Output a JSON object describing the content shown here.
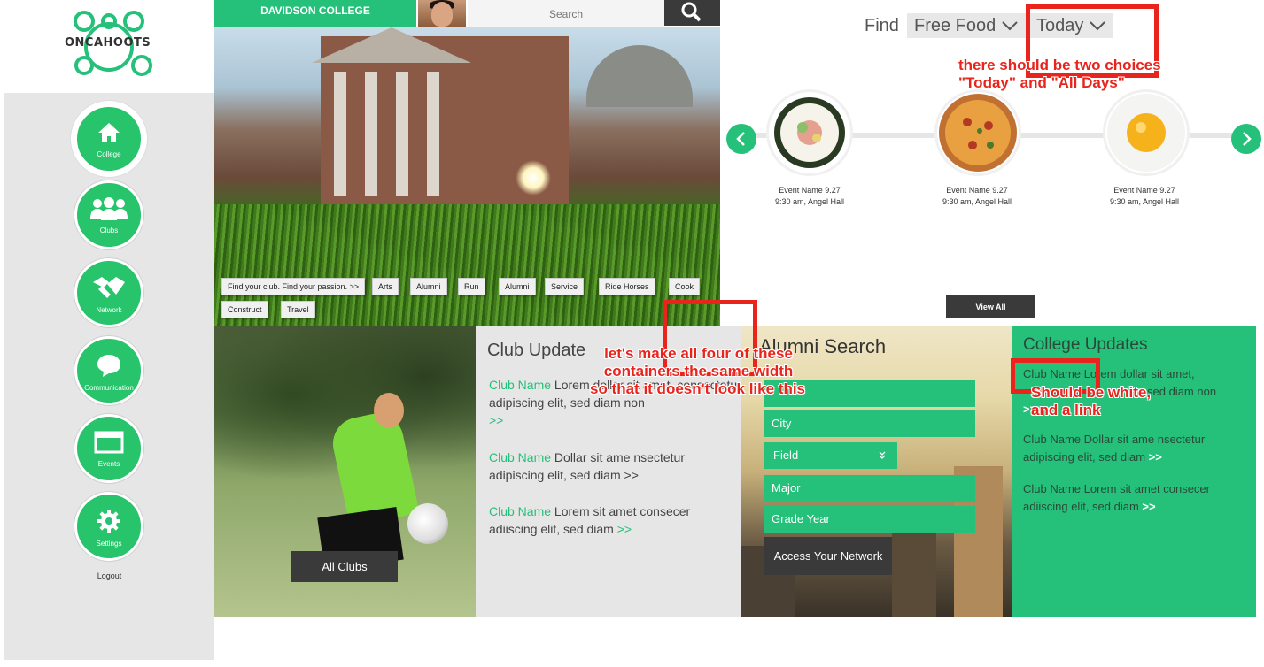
{
  "brand": {
    "logo_text": "ONCAHOOTS"
  },
  "sidebar": {
    "items": [
      {
        "label": "College",
        "icon": "home-icon"
      },
      {
        "label": "Clubs",
        "icon": "group-icon"
      },
      {
        "label": "Network",
        "icon": "handshake-icon"
      },
      {
        "label": "Communication",
        "icon": "chat-bubble-icon"
      },
      {
        "label": "Events",
        "icon": "calendar-window-icon"
      },
      {
        "label": "Settings",
        "icon": "gear-icon"
      }
    ],
    "logout": "Logout"
  },
  "header": {
    "college_name": "DAVIDSON COLLEGE",
    "search_placeholder": "Search"
  },
  "hero": {
    "tags": [
      "Find your club. Find your passion. >>",
      "Arts",
      "Alumni",
      "Run",
      "Alumni",
      "Service",
      "Ride Horses",
      "Cook",
      "Construct",
      "Travel"
    ]
  },
  "finder": {
    "label": "Find",
    "category": "Free Food",
    "when": "Today",
    "view_all": "View All",
    "events": [
      {
        "food": "sushi",
        "name": "Event Name 9.27",
        "detail": "9:30 am, Angel Hall"
      },
      {
        "food": "pizza",
        "name": "Event Name 9.27",
        "detail": "9:30 am, Angel Hall"
      },
      {
        "food": "egg",
        "name": "Event Name 9.27",
        "detail": "9:30 am, Angel Hall"
      }
    ]
  },
  "clubs": {
    "all_clubs_button": "All Clubs",
    "title": "Club Update",
    "updates": [
      {
        "name": "Club Name",
        "text": " Lorem dollar sit amet, consectetur adipiscing elit, sed diam non",
        "more": ">>"
      },
      {
        "name": "Club Name",
        "text": " Dollar sit ame nsectetur adipiscing elit, sed diam >>",
        "more": ""
      },
      {
        "name": "Club Name",
        "text": " Lorem sit amet consecer adiiscing elit, sed diam",
        "more": ">>"
      }
    ]
  },
  "alumni": {
    "title": "Alumni Search",
    "fields": [
      "",
      "City",
      "Field",
      "Major",
      "Grade Year"
    ],
    "access_button": "Access Your Network"
  },
  "college_updates": {
    "title": "College Updates",
    "updates": [
      {
        "name": "Club Name L",
        "text": "orem dollar sit amet,",
        "line2": "sed diam non",
        "more": ">>"
      },
      {
        "name": "Club Name",
        "text": " Dollar sit ame nsectetur adipiscing elit, sed diam",
        "more": ">>"
      },
      {
        "name": "Club Name",
        "text": " Lorem sit amet consecer adiiscing elit, sed diam",
        "more": ">>"
      }
    ]
  },
  "annotations": {
    "note1_line1": "there should be two choices",
    "note1_line2": "\"Today\" and \"All Days\"",
    "note2_line1": "let's make all four of these",
    "note2_line2": "containers the same width",
    "note2_line3": "so that it doesn't look like this",
    "note3_line1": "Should be white,",
    "note3_line2": "and a link",
    "color": "#e8241c"
  },
  "colors": {
    "accent": "#25c07a",
    "dark_button": "#3a3a3a",
    "sidebar_bg": "#e6e6e6"
  }
}
